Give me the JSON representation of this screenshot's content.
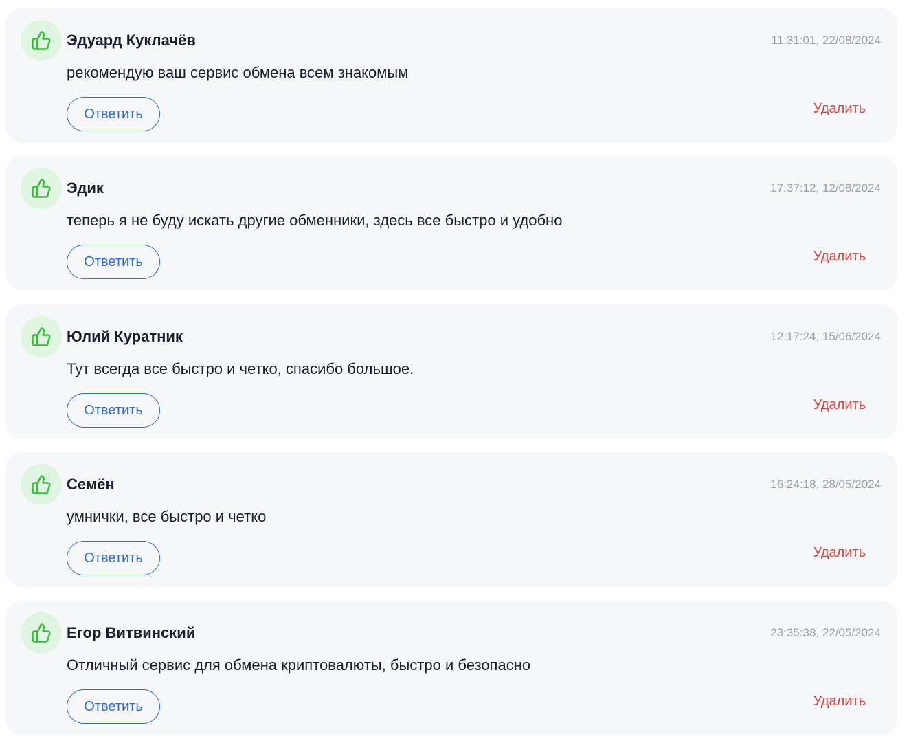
{
  "colors": {
    "card_background": "#f6f7f9",
    "avatar_background": "#dff5e2",
    "like_icon": "#3cb83f",
    "reply_accent": "#2e6ad8",
    "delete_accent": "#e0403f",
    "timestamp": "#9aa0a8",
    "text": "#1a1f2c"
  },
  "icons": {
    "avatar": "thumbs-up-icon"
  },
  "reviews": [
    {
      "author": "Эдуард Куклачёв",
      "timestamp": "11:31:01, 22/08/2024",
      "text": "рекомендую ваш сервис обмена всем знакомым",
      "reply_label": "Ответить",
      "delete_label": "Удалить"
    },
    {
      "author": "Эдик",
      "timestamp": "17:37:12, 12/08/2024",
      "text": "теперь я не буду искать другие обменники, здесь все быстро и удобно",
      "reply_label": "Ответить",
      "delete_label": "Удалить"
    },
    {
      "author": "Юлий Куратник",
      "timestamp": "12:17:24, 15/06/2024",
      "text": "Тут всегда все быстро и четко, спасибо большое.",
      "reply_label": "Ответить",
      "delete_label": "Удалить"
    },
    {
      "author": "Семён",
      "timestamp": "16:24:18, 28/05/2024",
      "text": "умнички, все быстро и четко",
      "reply_label": "Ответить",
      "delete_label": "Удалить"
    },
    {
      "author": "Егор Витвинский",
      "timestamp": "23:35:38, 22/05/2024",
      "text": "Отличный сервис для обмена криптовалюты, быстро и безопасно",
      "reply_label": "Ответить",
      "delete_label": "Удалить"
    }
  ]
}
